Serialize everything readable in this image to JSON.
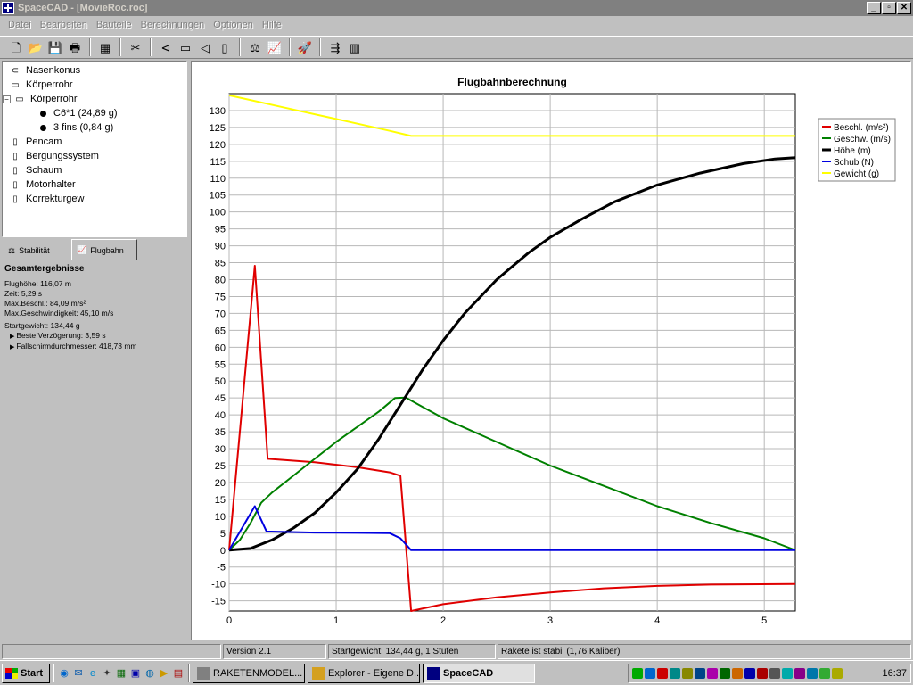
{
  "window": {
    "title": "SpaceCAD - [MovieRoc.roc]",
    "buttons": {
      "minimize": "_",
      "maximize": "▫",
      "close": "✕"
    }
  },
  "menu": [
    "Datei",
    "Bearbeiten",
    "Bauteile",
    "Berechnungen",
    "Optionen",
    "Hilfe"
  ],
  "toolbar": [
    {
      "name": "new-icon",
      "glyph": "🗋"
    },
    {
      "name": "open-icon",
      "glyph": "📂"
    },
    {
      "name": "save-icon",
      "glyph": "💾"
    },
    {
      "name": "print-icon",
      "glyph": "🖶"
    },
    {
      "sep": true
    },
    {
      "name": "properties-icon",
      "glyph": "▦"
    },
    {
      "sep": true
    },
    {
      "name": "cut-icon",
      "glyph": "✂"
    },
    {
      "sep": true
    },
    {
      "name": "nosecone-icon",
      "glyph": "⊲"
    },
    {
      "name": "bodytube-icon",
      "glyph": "▭"
    },
    {
      "name": "transition-icon",
      "glyph": "◁"
    },
    {
      "name": "inner-part-icon",
      "glyph": "▯"
    },
    {
      "sep": true
    },
    {
      "name": "stability-icon",
      "glyph": "⚖"
    },
    {
      "name": "flightpath-icon",
      "glyph": "📈"
    },
    {
      "sep": true
    },
    {
      "name": "simulate-icon",
      "glyph": "🚀"
    },
    {
      "sep": true
    },
    {
      "name": "export-icon",
      "glyph": "⇶"
    },
    {
      "name": "layout-icon",
      "glyph": "▥"
    }
  ],
  "tree": [
    {
      "label": "Nasenkonus",
      "level": 0,
      "icon": "nosecone-icon"
    },
    {
      "label": "Körperrohr",
      "level": 0,
      "icon": "bodytube-icon"
    },
    {
      "label": "Körperrohr",
      "level": 0,
      "icon": "bodytube-icon",
      "expanded": true
    },
    {
      "label": "C6*1 (24,89 g)",
      "level": 1,
      "icon": "bullet-icon"
    },
    {
      "label": "3 fins (0,84 g)",
      "level": 1,
      "icon": "bullet-icon"
    },
    {
      "label": "Pencam",
      "level": 0,
      "icon": "component-icon"
    },
    {
      "label": "Bergungssystem",
      "level": 0,
      "icon": "component-icon"
    },
    {
      "label": "Schaum",
      "level": 0,
      "icon": "component-icon"
    },
    {
      "label": "Motorhalter",
      "level": 0,
      "icon": "component-icon"
    },
    {
      "label": "Korrekturgew",
      "level": 0,
      "icon": "component-icon"
    }
  ],
  "tabs": {
    "stability": "Stabilität",
    "flightpath": "Flugbahn"
  },
  "results": {
    "title": "Gesamtergebnisse",
    "lines": [
      "Flughöhe: 116,07 m",
      "Zeit: 5,29 s",
      "Max.Beschl.: 84,09 m/s²",
      "Max.Geschwindigkeit: 45,10 m/s"
    ],
    "startweight": "Startgewicht: 134,44 g",
    "sub": [
      "Beste Verzögerung: 3,59 s",
      "Fallschirmdurchmesser: 418,73 mm"
    ]
  },
  "chart_data": {
    "type": "line",
    "title": "Flugbahnberechnung",
    "xlim": [
      0,
      5.29
    ],
    "ylim": [
      -18,
      135
    ],
    "xticks": [
      0,
      1,
      2,
      3,
      4,
      5
    ],
    "yticks": [
      -15,
      -10,
      -5,
      0,
      5,
      10,
      15,
      20,
      25,
      30,
      35,
      40,
      45,
      50,
      55,
      60,
      65,
      70,
      75,
      80,
      85,
      90,
      95,
      100,
      105,
      110,
      115,
      120,
      125,
      130
    ],
    "grid": true,
    "legend_position": "top-right",
    "series": [
      {
        "name": "Beschl. (m/s²)",
        "color": "#e00000",
        "points": [
          [
            0,
            0
          ],
          [
            0.24,
            84.09
          ],
          [
            0.36,
            27
          ],
          [
            0.8,
            26
          ],
          [
            1.2,
            24.5
          ],
          [
            1.5,
            23
          ],
          [
            1.6,
            22
          ],
          [
            1.7,
            -18
          ],
          [
            2.0,
            -16
          ],
          [
            2.5,
            -14
          ],
          [
            3.0,
            -12.5
          ],
          [
            3.5,
            -11.3
          ],
          [
            4.0,
            -10.6
          ],
          [
            4.5,
            -10.2
          ],
          [
            5.29,
            -10
          ]
        ]
      },
      {
        "name": "Geschw. (m/s)",
        "color": "#008000",
        "points": [
          [
            0,
            0
          ],
          [
            0.1,
            3
          ],
          [
            0.2,
            8
          ],
          [
            0.3,
            14
          ],
          [
            0.4,
            17
          ],
          [
            0.6,
            22
          ],
          [
            0.8,
            27
          ],
          [
            1.0,
            32
          ],
          [
            1.2,
            36.5
          ],
          [
            1.4,
            41
          ],
          [
            1.55,
            45
          ],
          [
            1.65,
            45.1
          ],
          [
            1.8,
            42.5
          ],
          [
            2.0,
            39
          ],
          [
            2.5,
            32
          ],
          [
            3.0,
            25
          ],
          [
            3.5,
            19
          ],
          [
            4.0,
            13
          ],
          [
            4.5,
            8
          ],
          [
            5.0,
            3.5
          ],
          [
            5.29,
            0
          ]
        ]
      },
      {
        "name": "Höhe (m)",
        "color": "#000000",
        "points": [
          [
            0,
            0
          ],
          [
            0.2,
            0.5
          ],
          [
            0.4,
            3
          ],
          [
            0.6,
            6.5
          ],
          [
            0.8,
            11
          ],
          [
            1.0,
            17
          ],
          [
            1.2,
            24
          ],
          [
            1.4,
            33
          ],
          [
            1.6,
            43
          ],
          [
            1.8,
            53
          ],
          [
            2.0,
            62
          ],
          [
            2.2,
            70
          ],
          [
            2.5,
            80
          ],
          [
            2.8,
            88
          ],
          [
            3.0,
            92.5
          ],
          [
            3.3,
            98
          ],
          [
            3.6,
            103
          ],
          [
            4.0,
            108
          ],
          [
            4.4,
            111.5
          ],
          [
            4.8,
            114.3
          ],
          [
            5.1,
            115.7
          ],
          [
            5.29,
            116.07
          ]
        ]
      },
      {
        "name": "Schub (N)",
        "color": "#0000e0",
        "points": [
          [
            0,
            0
          ],
          [
            0.24,
            13
          ],
          [
            0.35,
            5.5
          ],
          [
            0.8,
            5.2
          ],
          [
            1.2,
            5.1
          ],
          [
            1.5,
            5.0
          ],
          [
            1.6,
            3.5
          ],
          [
            1.7,
            0
          ],
          [
            5.29,
            0
          ]
        ]
      },
      {
        "name": "Gewicht (g)",
        "color": "#ffff00",
        "points": [
          [
            0,
            134.44
          ],
          [
            0.01,
            134.44
          ],
          [
            0.5,
            131
          ],
          [
            1.0,
            127.5
          ],
          [
            1.5,
            124
          ],
          [
            1.7,
            122.5
          ],
          [
            5.29,
            122.5
          ]
        ]
      }
    ]
  },
  "statusbar": {
    "version": "Version 2.1",
    "startweight": "Startgewicht: 134,44 g, 1 Stufen",
    "stability": "Rakete ist stabil (1,76 Kaliber)"
  },
  "taskbar": {
    "start": "Start",
    "tasks": [
      "RAKETENMODEL...",
      "Explorer - Eigene D...",
      "SpaceCAD"
    ],
    "clock": "16:37"
  }
}
